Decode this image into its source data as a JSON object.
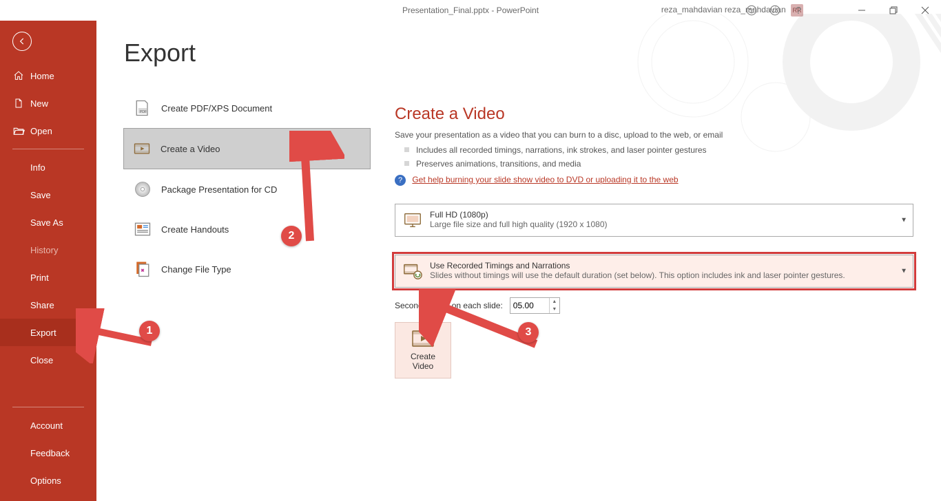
{
  "title": "Presentation_Final.pptx  -  PowerPoint",
  "user": "reza_mahdavian reza_mahdavian",
  "user_initials": "RR",
  "sidebar": {
    "home": "Home",
    "new": "New",
    "open": "Open",
    "info": "Info",
    "save": "Save",
    "saveas": "Save As",
    "history": "History",
    "print": "Print",
    "share": "Share",
    "export": "Export",
    "close": "Close",
    "account": "Account",
    "feedback": "Feedback",
    "options": "Options"
  },
  "export_heading": "Export",
  "export_items": {
    "pdf": "Create PDF/XPS Document",
    "video": "Create a Video",
    "cd": "Package Presentation for CD",
    "handouts": "Create Handouts",
    "filetype": "Change File Type"
  },
  "panel": {
    "title": "Create a Video",
    "desc": "Save your presentation as a video that you can burn to a disc, upload to the web, or email",
    "bullet1": "Includes all recorded timings, narrations, ink strokes, and laser pointer gestures",
    "bullet2": "Preserves animations, transitions, and media",
    "help_link": "Get help burning your slide show video to DVD or uploading it to the web",
    "quality_title": "Full HD (1080p)",
    "quality_sub": "Large file size and full high quality (1920 x 1080)",
    "timings_title": "Use Recorded Timings and Narrations",
    "timings_sub": "Slides without timings will use the default duration (set below). This option includes ink and laser pointer gestures.",
    "seconds_label": "Seconds spent on each slide:",
    "seconds_value": "05.00",
    "create_button_l1": "Create",
    "create_button_l2": "Video"
  },
  "annotations": {
    "a1": "1",
    "a2": "2",
    "a3": "3"
  }
}
